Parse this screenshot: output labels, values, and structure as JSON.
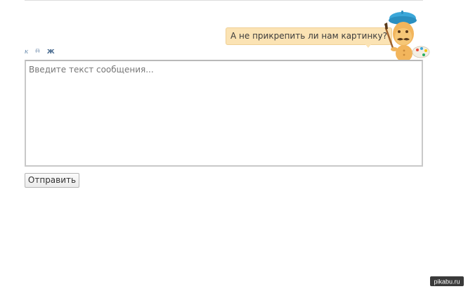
{
  "bubble": {
    "text": "А не прикрепить ли нам картинку?"
  },
  "toolbar": {
    "italic_label": "к",
    "strike_label": "п",
    "bold_label": "ж"
  },
  "message": {
    "placeholder": "Введите текст сообщения..."
  },
  "send_button": {
    "label": "Отправить"
  },
  "watermark": {
    "text": "pikabu.ru"
  },
  "colors": {
    "bubble_bg": "#fbe3b4",
    "toolbar_link": "#6f8fb0",
    "mascot_beret": "#3ba7d9",
    "mascot_body": "#f2b55c"
  }
}
